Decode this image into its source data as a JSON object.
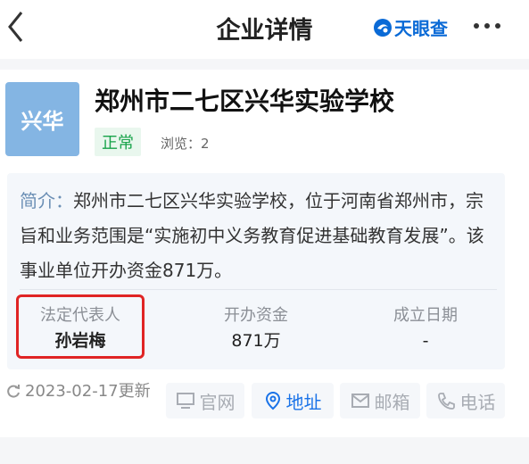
{
  "header": {
    "title": "企业详情",
    "brand": "天眼查",
    "brand_color": "#0a6ad6"
  },
  "company": {
    "logo_text": "兴华",
    "name": "郑州市二七区兴华实验学校",
    "status": "正常",
    "views": "浏览：2"
  },
  "intro": {
    "label": "简介：",
    "text": "郑州市二七区兴华实验学校，位于河南省郑州市，宗旨和业务范围是“实施初中义务教育促进基础教育发展”。该事业单位开办资金871万。"
  },
  "stats": [
    {
      "label": "法定代表人",
      "value": "孙岩梅"
    },
    {
      "label": "开办资金",
      "value": "871万"
    },
    {
      "label": "成立日期",
      "value": "-"
    }
  ],
  "updated": "2023-02-17更新",
  "actions": [
    {
      "label": "官网",
      "icon": "monitor-icon",
      "active": false
    },
    {
      "label": "地址",
      "icon": "location-icon",
      "active": true
    },
    {
      "label": "邮箱",
      "icon": "mail-icon",
      "active": false
    },
    {
      "label": "电话",
      "icon": "phone-icon",
      "active": false
    }
  ],
  "colors": {
    "status_green": "#17a34a",
    "highlight_red": "#e02424",
    "active_blue": "#1a73e8"
  }
}
